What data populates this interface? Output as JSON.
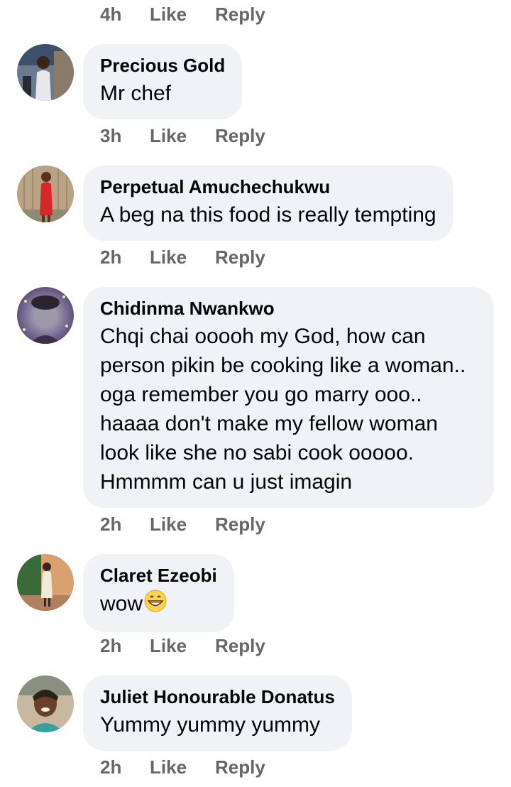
{
  "comments": [
    {
      "name": "",
      "text": "",
      "time": "4h",
      "like_label": "Like",
      "reply_label": "Reply"
    },
    {
      "name": "Precious Gold",
      "text": "Mr chef",
      "time": "3h",
      "like_label": "Like",
      "reply_label": "Reply"
    },
    {
      "name": "Perpetual Amuchechukwu",
      "text": "A beg na this food is really tempting",
      "time": "2h",
      "like_label": "Like",
      "reply_label": "Reply"
    },
    {
      "name": "Chidinma Nwankwo",
      "text": "Chqi chai ooooh my God, how can person pikin be cooking like a woman.. oga remember you go marry ooo.. haaaa don't make my fellow woman look like she no sabi cook ooooo. Hmmmm can u just imagin",
      "time": "2h",
      "like_label": "Like",
      "reply_label": "Reply"
    },
    {
      "name": "Claret Ezeobi",
      "text": "wow",
      "emoji": "grinning-face-emoji",
      "time": "2h",
      "like_label": "Like",
      "reply_label": "Reply"
    },
    {
      "name": "Juliet Honourable Donatus",
      "text": "Yummy yummy yummy",
      "time": "2h",
      "like_label": "Like",
      "reply_label": "Reply"
    }
  ],
  "colors": {
    "bubble_bg": "#f0f2f5",
    "name_text": "#050505",
    "meta_text": "#65676b"
  }
}
